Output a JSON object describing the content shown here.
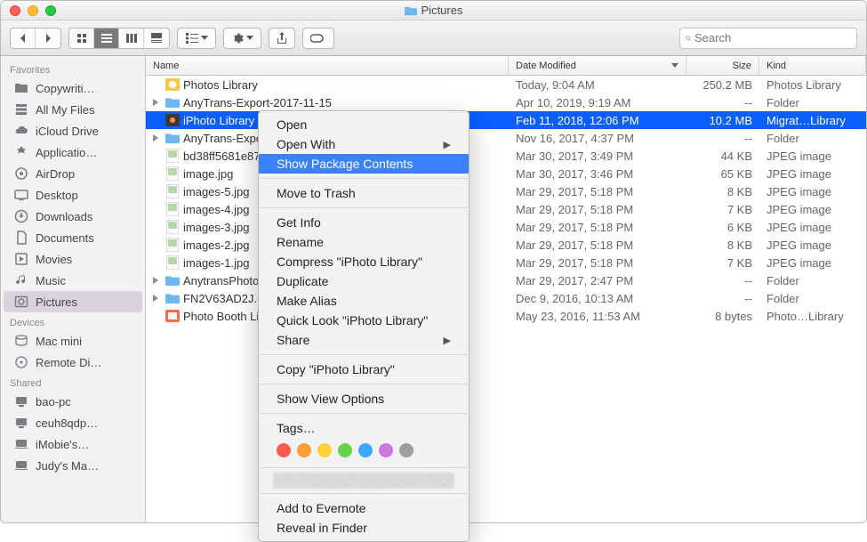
{
  "window_title": "Pictures",
  "search_placeholder": "Search",
  "columns": {
    "name": "Name",
    "date": "Date Modified",
    "size": "Size",
    "kind": "Kind"
  },
  "sidebar": {
    "sections": [
      {
        "title": "Favorites",
        "items": [
          {
            "label": "Copywriti…",
            "icon": "folder"
          },
          {
            "label": "All My Files",
            "icon": "allfiles"
          },
          {
            "label": "iCloud Drive",
            "icon": "cloud"
          },
          {
            "label": "Applicatio…",
            "icon": "apps"
          },
          {
            "label": "AirDrop",
            "icon": "airdrop"
          },
          {
            "label": "Desktop",
            "icon": "desktop"
          },
          {
            "label": "Downloads",
            "icon": "downloads"
          },
          {
            "label": "Documents",
            "icon": "documents"
          },
          {
            "label": "Movies",
            "icon": "movies"
          },
          {
            "label": "Music",
            "icon": "music"
          },
          {
            "label": "Pictures",
            "icon": "pictures",
            "selected": true
          }
        ]
      },
      {
        "title": "Devices",
        "items": [
          {
            "label": "Mac mini",
            "icon": "disk"
          },
          {
            "label": "Remote Di…",
            "icon": "remote"
          }
        ]
      },
      {
        "title": "Shared",
        "items": [
          {
            "label": "bao-pc",
            "icon": "pc"
          },
          {
            "label": "ceuh8qdp…",
            "icon": "pc"
          },
          {
            "label": "iMobie's…",
            "icon": "mac"
          },
          {
            "label": "Judy's Ma…",
            "icon": "mac"
          }
        ]
      }
    ]
  },
  "files": [
    {
      "name": "Photos Library",
      "date": "Today, 9:04 AM",
      "size": "250.2 MB",
      "kind": "Photos Library",
      "icon": "photoslib"
    },
    {
      "name": "AnyTrans-Export-2017-11-15",
      "date": "Apr 10, 2019, 9:19 AM",
      "size": "--",
      "kind": "Folder",
      "icon": "folder",
      "expandable": true
    },
    {
      "name": "iPhoto Library",
      "date": "Feb 11, 2018, 12:06 PM",
      "size": "10.2 MB",
      "kind": "Migrat…Library",
      "icon": "iphotolib",
      "selected": true
    },
    {
      "name": "AnyTrans-Export",
      "date": "Nov 16, 2017, 4:37 PM",
      "size": "--",
      "kind": "Folder",
      "icon": "folder",
      "expandable": true
    },
    {
      "name": "bd38ff5681e87",
      "date": "Mar 30, 2017, 3:49 PM",
      "size": "44 KB",
      "kind": "JPEG image",
      "icon": "jpeg"
    },
    {
      "name": "image.jpg",
      "date": "Mar 30, 2017, 3:46 PM",
      "size": "65 KB",
      "kind": "JPEG image",
      "icon": "jpeg"
    },
    {
      "name": "images-5.jpg",
      "date": "Mar 29, 2017, 5:18 PM",
      "size": "8 KB",
      "kind": "JPEG image",
      "icon": "jpeg"
    },
    {
      "name": "images-4.jpg",
      "date": "Mar 29, 2017, 5:18 PM",
      "size": "7 KB",
      "kind": "JPEG image",
      "icon": "jpeg"
    },
    {
      "name": "images-3.jpg",
      "date": "Mar 29, 2017, 5:18 PM",
      "size": "6 KB",
      "kind": "JPEG image",
      "icon": "jpeg"
    },
    {
      "name": "images-2.jpg",
      "date": "Mar 29, 2017, 5:18 PM",
      "size": "8 KB",
      "kind": "JPEG image",
      "icon": "jpeg"
    },
    {
      "name": "images-1.jpg",
      "date": "Mar 29, 2017, 5:18 PM",
      "size": "7 KB",
      "kind": "JPEG image",
      "icon": "jpeg"
    },
    {
      "name": "AnytransPhotoB",
      "date": "Mar 29, 2017, 2:47 PM",
      "size": "--",
      "kind": "Folder",
      "icon": "folder",
      "expandable": true
    },
    {
      "name": "FN2V63AD2J.co",
      "date": "Dec 9, 2016, 10:13 AM",
      "size": "--",
      "kind": "Folder",
      "icon": "folder",
      "expandable": true
    },
    {
      "name": "Photo Booth Lib",
      "date": "May 23, 2016, 11:53 AM",
      "size": "8 bytes",
      "kind": "Photo…Library",
      "icon": "photobooth"
    }
  ],
  "menu": {
    "open": "Open",
    "open_with": "Open With",
    "show_pkg": "Show Package Contents",
    "trash": "Move to Trash",
    "get_info": "Get Info",
    "rename": "Rename",
    "compress": "Compress \"iPhoto Library\"",
    "duplicate": "Duplicate",
    "alias": "Make Alias",
    "quicklook": "Quick Look \"iPhoto Library\"",
    "share": "Share",
    "copy": "Copy \"iPhoto Library\"",
    "view_opts": "Show View Options",
    "tags": "Tags…",
    "evernote": "Add to Evernote",
    "reveal": "Reveal in Finder"
  },
  "tag_colors": [
    "#ff5a4e",
    "#ff9d33",
    "#ffd335",
    "#64d24b",
    "#3fa6ff",
    "#c978dd",
    "#9e9e9e"
  ]
}
